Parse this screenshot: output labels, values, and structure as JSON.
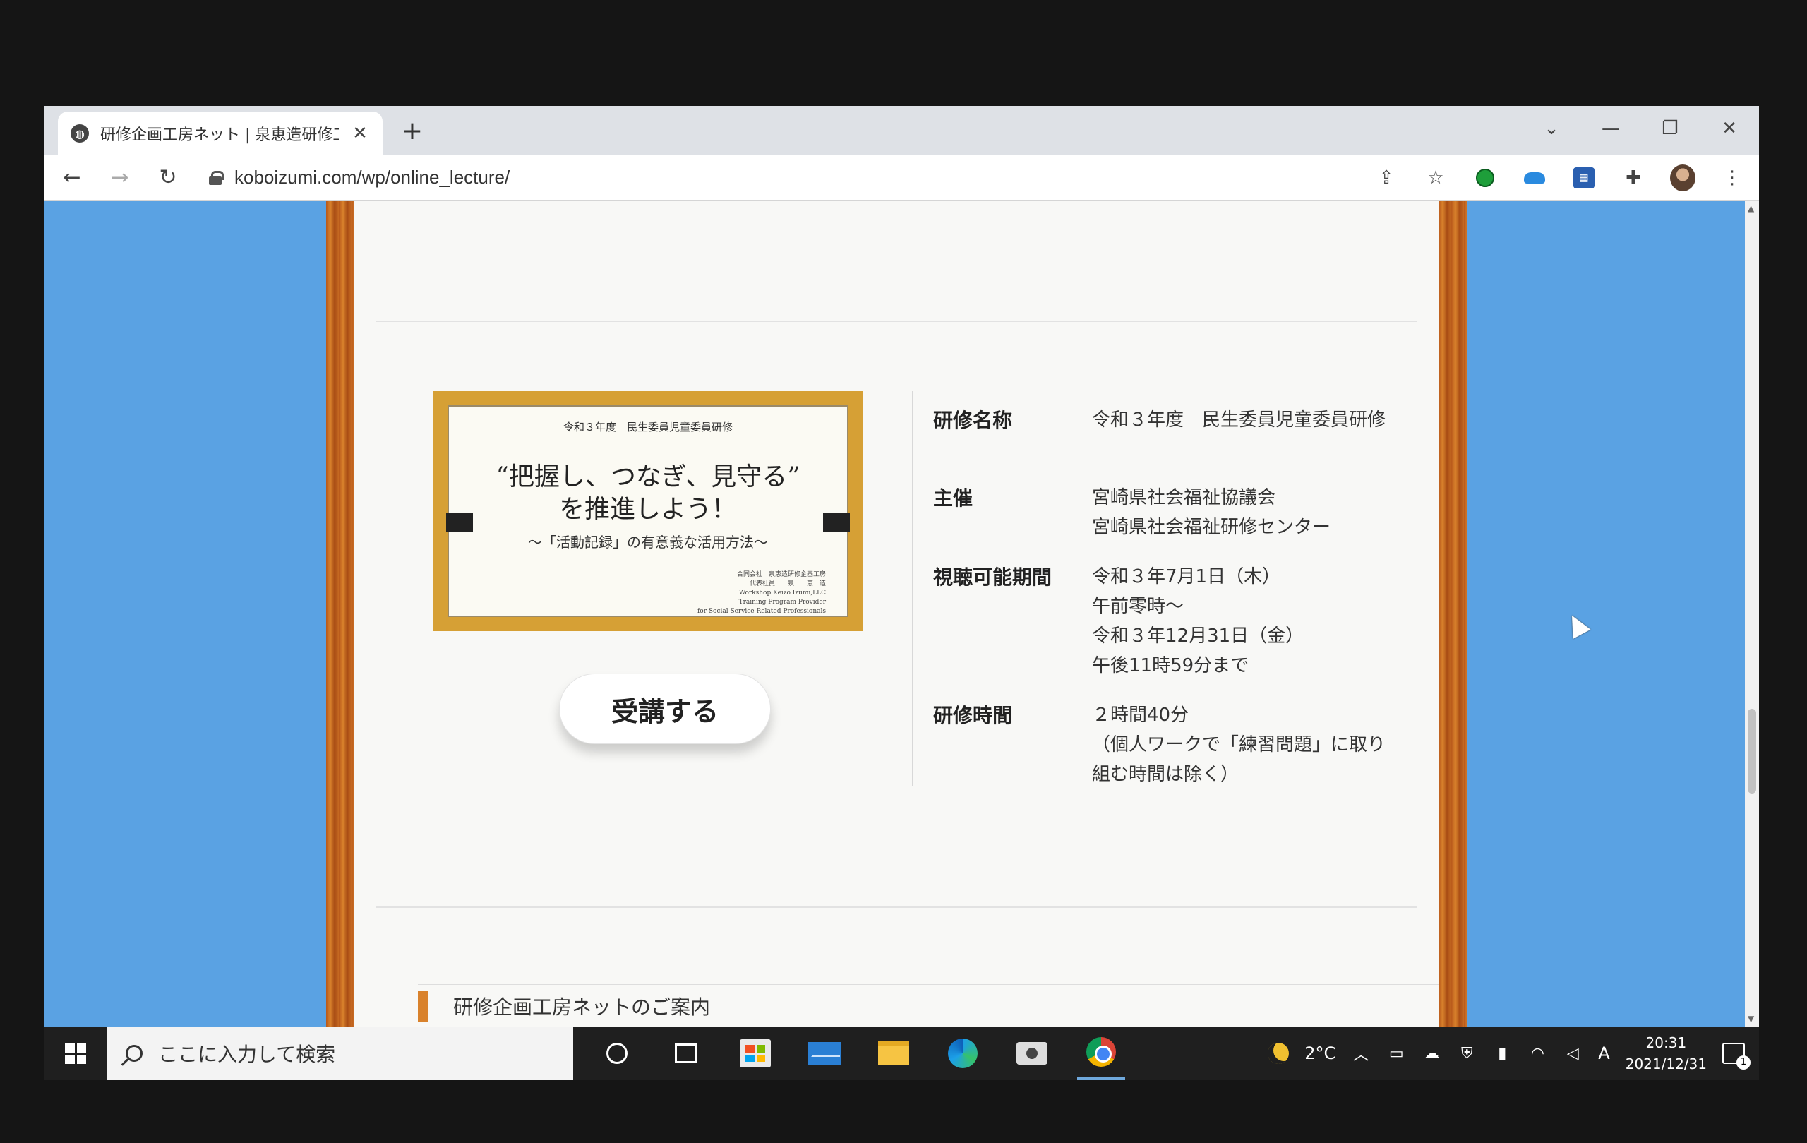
{
  "browser": {
    "tab": {
      "title": "研修企画工房ネット | 泉恵造研修工房",
      "close_glyph": "✕"
    },
    "new_tab_glyph": "+",
    "window_controls": [
      "⌄",
      "—",
      "❐",
      "✕"
    ],
    "url": "koboizumi.com/wp/online_lecture/"
  },
  "poster": {
    "subtitle": "令和３年度　民生委員児童委員研修",
    "title_line1": "“把握し、つなぎ、見守る”",
    "title_line2": "を推進しよう！",
    "tagline": "〜「活動記録」の有意義な活用方法〜",
    "credit_lines": [
      "合同会社　泉恵造研修企画工房",
      "代表社員　　泉　　恵　造",
      "Workshop Keizo Izumi,LLC",
      "Training Program Provider",
      "for Social Service Related Professionals"
    ]
  },
  "enroll_button": "受講する",
  "info": [
    {
      "key": "研修名称",
      "value": "令和３年度　民生委員児童委員研修"
    },
    {
      "key": "主催",
      "value": "宮崎県社会福祉協議会\n宮崎県社会福祉研修センター"
    },
    {
      "key": "視聴可能期間",
      "value": "令和３年7月1日（木）\n午前零時〜\n令和３年12月31日（金）\n午後11時59分まで"
    },
    {
      "key": "研修時間",
      "value": "２時間40分\n（個人ワークで「練習問題」に取り組む時間は除く）"
    }
  ],
  "section_heading": "研修企画工房ネットのご案内",
  "taskbar": {
    "search_placeholder": "ここに入力して検索",
    "weather": "2°C",
    "ime": "A",
    "time": "20:31",
    "date": "2021/12/31",
    "notification_count": "1"
  },
  "colors": {
    "page_background": "#5aa2e3",
    "wood_frame": "#d9822c",
    "poster_frame": "#d6a035"
  }
}
